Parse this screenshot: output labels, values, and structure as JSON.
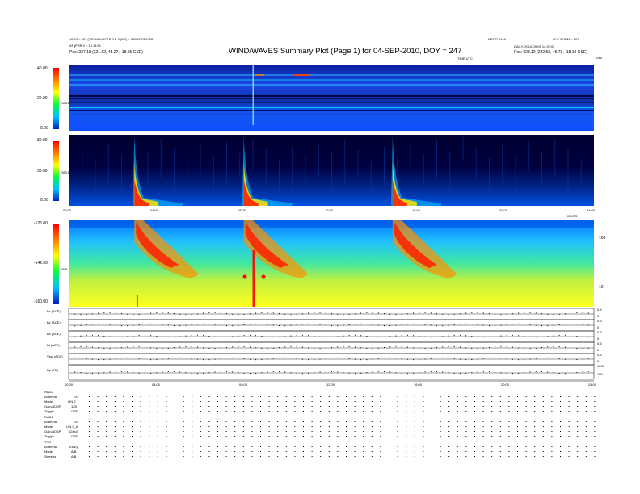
{
  "header": {
    "title": "WIND/WAVES Summary Plot (Page 1) for 04-SEP-2010, DOY = 247",
    "left_line1": "16:52 = 502 (200 MHz/POLE 0 B 0 (NE) = 5 ROS DRGBP",
    "left_line2": "ATgPRR 2 = 13 15:51",
    "left_pos": "Pos:   227.18 (221.62, 45.27, -18.55 GSE)",
    "right_id": "MFCO 2448",
    "right_daily": "DAILY: 2010-09-05 14:32:03",
    "right_l0": "L0 E FORM = 502",
    "right_pos": "Pos:   228.12 (222.52, 45.76, -18.19 GSE)",
    "time_label": "TIME UTC",
    "doy_right": "248"
  },
  "panels": [
    {
      "name": "RAD2",
      "yticks": [
        "40.00",
        "20.00",
        "0.00"
      ]
    },
    {
      "name": "RAD1",
      "yticks": [
        "80.00",
        "30.00",
        "0.00"
      ]
    },
    {
      "name": "TNR",
      "yticks": [
        "-125.00",
        "-142.50",
        "-160.00"
      ],
      "right_ticks": [
        "100",
        "10"
      ]
    }
  ],
  "time_axis": {
    "labels": [
      "00:00",
      "04:00",
      "08:00",
      "12:00",
      "16:00",
      "20:00",
      "24:00"
    ],
    "hours_label": "HOURS"
  },
  "small_panels": [
    {
      "label": "Bx (ACE)",
      "right": [
        "0.5",
        "0"
      ]
    },
    {
      "label": "By (ACE)",
      "right": [
        "0.5",
        "0"
      ]
    },
    {
      "label": "Bz (ACE)",
      "right": [
        "0.5",
        "0"
      ]
    },
    {
      "label": "Bt (ACE)",
      "right": [
        "0.5",
        "0"
      ]
    },
    {
      "label": "Vsw (ACE)",
      "right": [
        "0.5",
        "0"
      ]
    },
    {
      "label": "Np (TP)",
      "right": [
        "1000",
        "100"
      ]
    }
  ],
  "bottom_axis": {
    "labels": [
      "00:00",
      "04:00",
      "08:00",
      "12:00",
      "16:00",
      "20:00",
      "24:00"
    ]
  },
  "settings": {
    "rad2": {
      "header": "RAD2",
      "rows": [
        [
          "Antenna",
          "Ex"
        ],
        [
          "Mode",
          "LIN 2"
        ],
        [
          "Gain/ADSP",
          "128"
        ],
        [
          "Toggle",
          "OFF"
        ]
      ]
    },
    "rad1": {
      "header": "RAD1",
      "rows": [
        [
          "Antenna",
          "Ex"
        ],
        [
          "Mode",
          "LIN 2_A"
        ],
        [
          "Gain/ADSP",
          "128x4"
        ],
        [
          "Toggle",
          "OFF"
        ]
      ]
    },
    "tnr": {
      "header": "TNR",
      "rows": [
        [
          "Antenna",
          "Ex/Ey"
        ],
        [
          "Mode",
          "A/B"
        ],
        [
          "Sweeps",
          "A/B"
        ]
      ]
    }
  },
  "colors": {
    "bg_dark": "#000060",
    "bg_blue": "#1040ff",
    "burst_red": "#ff2000",
    "burst_yellow": "#ffff00",
    "tnr_base": "#a0e000"
  },
  "chart_data": {
    "type": "heatmap",
    "title": "WIND/WAVES Summary Plot (Page 1) for 04-SEP-2010, DOY = 247",
    "xlabel": "TIME UTC",
    "x_range_hours": [
      0,
      24
    ],
    "panels": [
      {
        "name": "RAD2",
        "ylim": [
          0,
          40
        ],
        "ylabel": "RAD2"
      },
      {
        "name": "RAD1",
        "ylim": [
          0,
          80
        ],
        "ylabel": "RAD1"
      },
      {
        "name": "TNR",
        "ylim": [
          -160,
          -125
        ],
        "ylabel": "TNR"
      }
    ],
    "radio_bursts_hours": [
      3.0,
      8.0,
      14.8
    ]
  }
}
